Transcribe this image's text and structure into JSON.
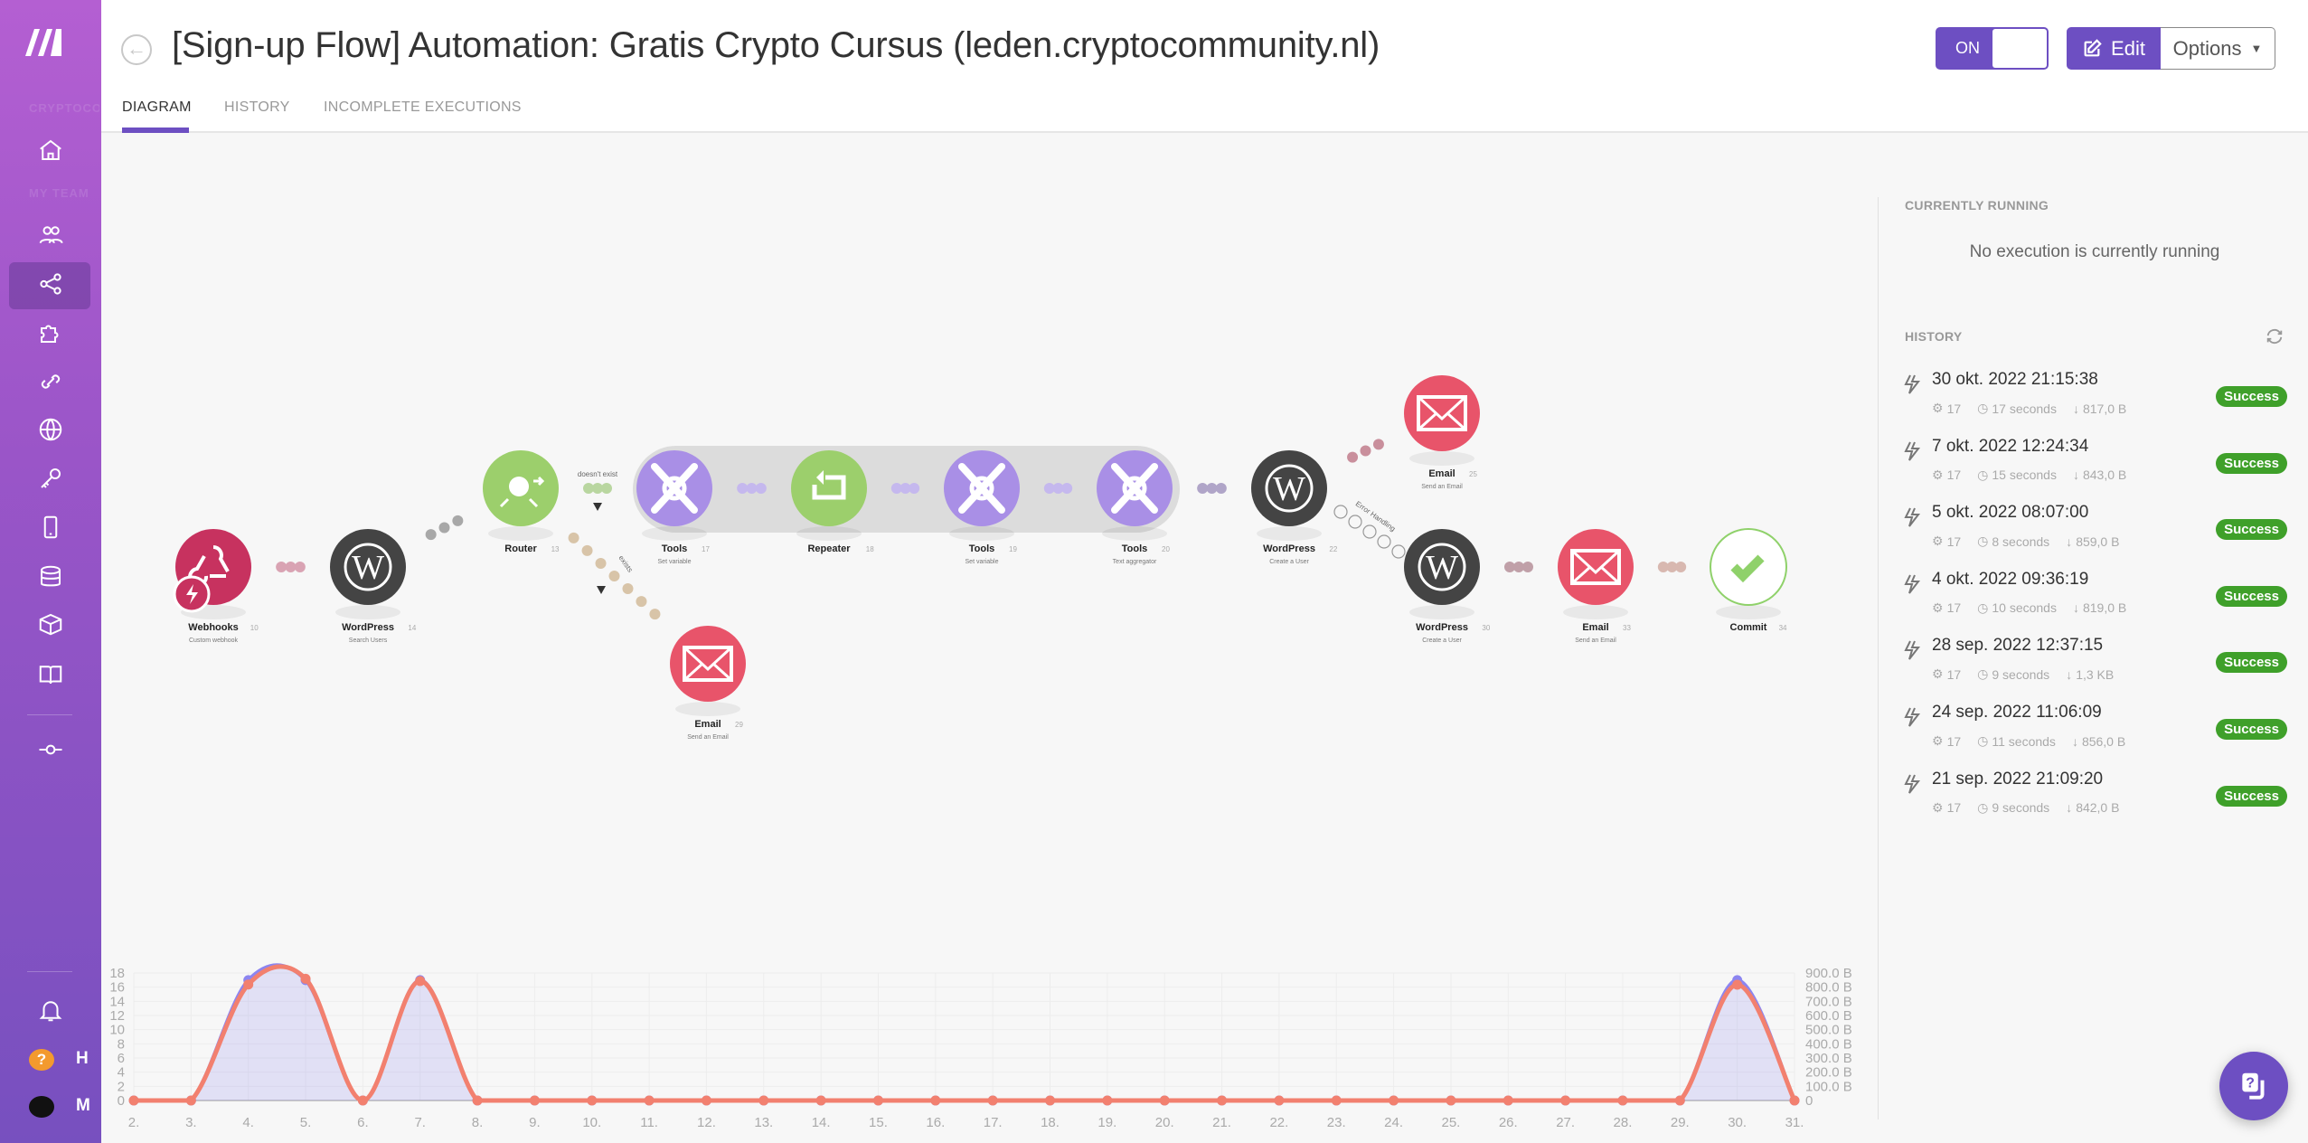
{
  "sidebar": {
    "org_label": "CRYPTOCO",
    "team_label": "MY TEAM",
    "items": [
      {
        "icon": "home-icon",
        "label": "Dashboard"
      },
      {
        "icon": "users-icon",
        "label": "Team"
      },
      {
        "icon": "share-icon",
        "label": "Scenarios",
        "active": true
      },
      {
        "icon": "puzzle-icon",
        "label": "Templates"
      },
      {
        "icon": "link-icon",
        "label": "Connections"
      },
      {
        "icon": "globe-icon",
        "label": "Webhooks"
      },
      {
        "icon": "key-icon",
        "label": "Keys"
      },
      {
        "icon": "device-icon",
        "label": "Devices"
      },
      {
        "icon": "database-icon",
        "label": "Data stores"
      },
      {
        "icon": "box-icon",
        "label": "Data structures"
      },
      {
        "icon": "book-icon",
        "label": "Documentation"
      },
      {
        "icon": "commit-icon",
        "label": "Version"
      }
    ],
    "help_initial": "H",
    "user_initial": "M"
  },
  "header": {
    "title": "[Sign-up Flow] Automation: Gratis Crypto Cursus (leden.cryptocommunity.nl)",
    "tabs": [
      "DIAGRAM",
      "HISTORY",
      "INCOMPLETE EXECUTIONS"
    ],
    "active_tab": "DIAGRAM",
    "toggle_label": "ON",
    "toggle_on": true,
    "edit_label": "Edit",
    "options_label": "Options"
  },
  "colors": {
    "accent": "#6d4fc2",
    "success": "#3fa02a",
    "webhook": "#c7325f",
    "wordpress": "#444444",
    "email": "#e8546a",
    "tools": "#a98fe6",
    "router": "#9ccf6c",
    "commit": "#8fd16a"
  },
  "diagram": {
    "nodes": [
      {
        "name": "Webhooks",
        "id": "10",
        "subtitle": "Custom webhook",
        "icon": "webhook-icon"
      },
      {
        "name": "WordPress",
        "id": "14",
        "subtitle": "Search Users",
        "icon": "wordpress-icon"
      },
      {
        "name": "Router",
        "id": "13",
        "subtitle": "",
        "icon": "router-icon"
      },
      {
        "name": "Tools",
        "id": "17",
        "subtitle": "Set variable",
        "icon": "tools-icon"
      },
      {
        "name": "Repeater",
        "id": "18",
        "subtitle": "",
        "icon": "repeater-icon"
      },
      {
        "name": "Tools",
        "id": "19",
        "subtitle": "Set variable",
        "icon": "tools-icon"
      },
      {
        "name": "Tools",
        "id": "20",
        "subtitle": "Text aggregator",
        "icon": "tools-icon"
      },
      {
        "name": "WordPress",
        "id": "22",
        "subtitle": "Create a User",
        "icon": "wordpress-icon"
      },
      {
        "name": "Email",
        "id": "25",
        "subtitle": "Send an Email",
        "icon": "email-icon"
      },
      {
        "name": "WordPress",
        "id": "30",
        "subtitle": "Create a User",
        "icon": "wordpress-icon"
      },
      {
        "name": "Email",
        "id": "33",
        "subtitle": "Send an Email",
        "icon": "email-icon"
      },
      {
        "name": "Commit",
        "id": "34",
        "subtitle": "",
        "icon": "check-icon"
      },
      {
        "name": "Email",
        "id": "29",
        "subtitle": "Send an Email",
        "icon": "email-icon"
      }
    ],
    "route_labels": {
      "doesnt_exist": "doesn't exist",
      "exists": "exists",
      "error_handling": "Error Handling"
    }
  },
  "right_panel": {
    "running_heading": "CURRENTLY RUNNING",
    "running_empty": "No execution is currently running",
    "history_heading": "HISTORY",
    "history": [
      {
        "date": "30 okt. 2022 21:15:38",
        "ops": "17",
        "duration": "17 seconds",
        "size": "817,0 B",
        "status": "Success"
      },
      {
        "date": "7 okt. 2022 12:24:34",
        "ops": "17",
        "duration": "15 seconds",
        "size": "843,0 B",
        "status": "Success"
      },
      {
        "date": "5 okt. 2022 08:07:00",
        "ops": "17",
        "duration": "8 seconds",
        "size": "859,0 B",
        "status": "Success"
      },
      {
        "date": "4 okt. 2022 09:36:19",
        "ops": "17",
        "duration": "10 seconds",
        "size": "819,0 B",
        "status": "Success"
      },
      {
        "date": "28 sep. 2022 12:37:15",
        "ops": "17",
        "duration": "9 seconds",
        "size": "1,3 KB",
        "status": "Success"
      },
      {
        "date": "24 sep. 2022 11:06:09",
        "ops": "17",
        "duration": "11 seconds",
        "size": "856,0 B",
        "status": "Success"
      },
      {
        "date": "21 sep. 2022 21:09:20",
        "ops": "17",
        "duration": "9 seconds",
        "size": "842,0 B",
        "status": "Success"
      }
    ]
  },
  "chart_data": {
    "type": "area",
    "categories": [
      "2.",
      "3.",
      "4.",
      "5.",
      "6.",
      "7.",
      "8.",
      "9.",
      "10.",
      "11.",
      "12.",
      "13.",
      "14.",
      "15.",
      "16.",
      "17.",
      "18.",
      "19.",
      "20.",
      "21.",
      "22.",
      "23.",
      "24.",
      "25.",
      "26.",
      "27.",
      "28.",
      "29.",
      "30.",
      "31."
    ],
    "series": [
      {
        "axis": "left",
        "color": "#8c85f0",
        "values": [
          0,
          0,
          17,
          17,
          0,
          17,
          0,
          0,
          0,
          0,
          0,
          0,
          0,
          0,
          0,
          0,
          0,
          0,
          0,
          0,
          0,
          0,
          0,
          0,
          0,
          0,
          0,
          0,
          17,
          0
        ]
      },
      {
        "axis": "right",
        "color": "#f2806f",
        "values": [
          0,
          0,
          819,
          859,
          0,
          843,
          0,
          0,
          0,
          0,
          0,
          0,
          0,
          0,
          0,
          0,
          0,
          0,
          0,
          0,
          0,
          0,
          0,
          0,
          0,
          0,
          0,
          0,
          817,
          0
        ]
      }
    ],
    "y_left": {
      "min": 0,
      "max": 18,
      "ticks": [
        "0",
        "2",
        "4",
        "6",
        "8",
        "10",
        "12",
        "14",
        "16",
        "18"
      ]
    },
    "y_right": {
      "min": 0,
      "max": 900,
      "ticks": [
        "0",
        "100.0 B",
        "200.0 B",
        "300.0 B",
        "400.0 B",
        "500.0 B",
        "600.0 B",
        "700.0 B",
        "800.0 B",
        "900.0 B"
      ]
    },
    "grid": true
  }
}
